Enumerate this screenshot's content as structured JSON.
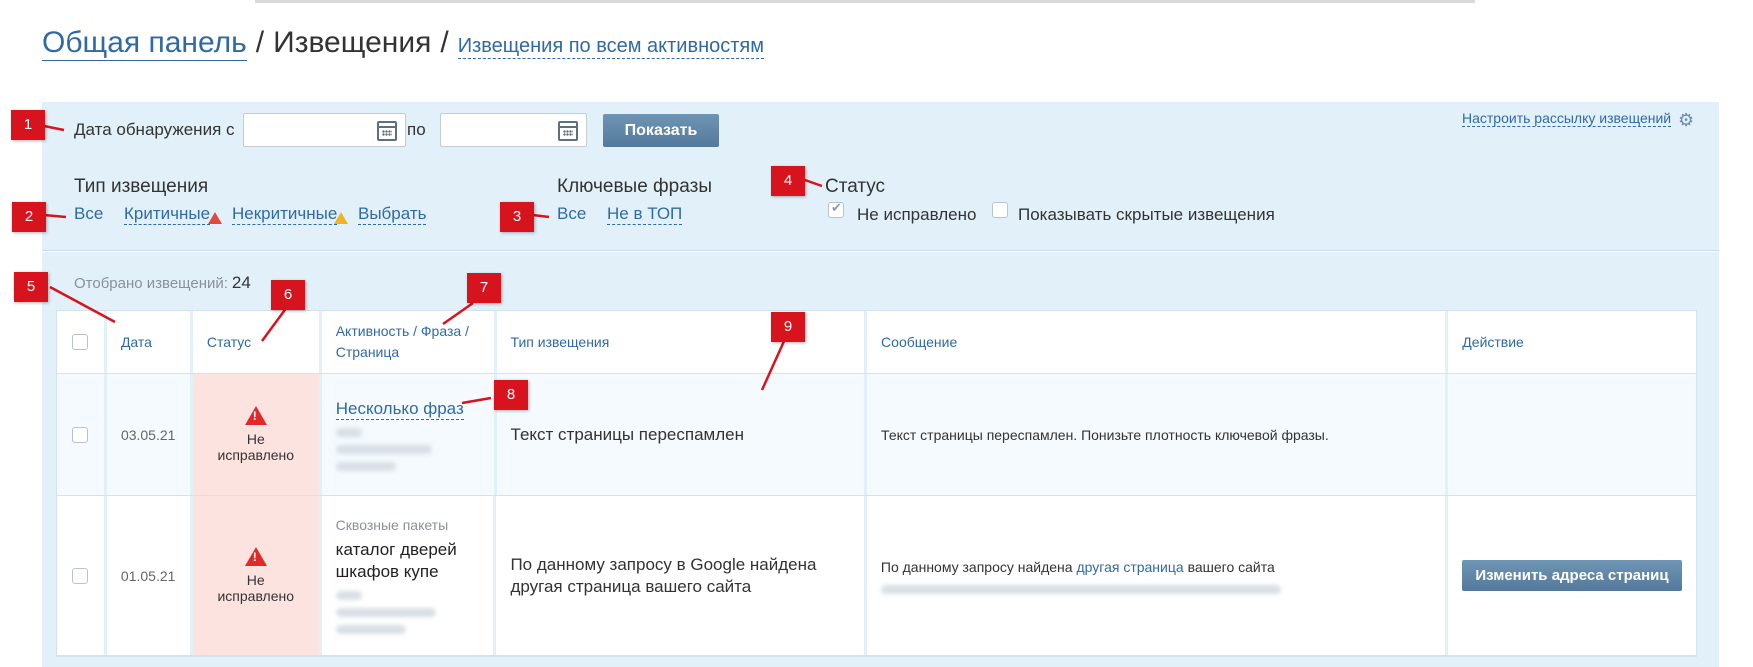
{
  "breadcrumb": {
    "root": "Общая панель",
    "sep1": "/",
    "current": "Извещения",
    "sep2": "/",
    "sub": "Извещения по всем активностям"
  },
  "filter": {
    "date_from_label": "Дата обнаружения с",
    "date_to_label": "по",
    "date_from_value": "",
    "date_to_value": "",
    "show_button": "Показать",
    "settings_link": "Настроить рассылку извещений",
    "notice_type": {
      "title": "Тип извещения",
      "all": "Все",
      "critical": "Критичные",
      "noncritical": "Некритичные",
      "choose": "Выбрать"
    },
    "keyphrases": {
      "title": "Ключевые фразы",
      "all": "Все",
      "not_top": "Не в ТОП"
    },
    "status": {
      "title": "Статус",
      "not_fixed": "Не исправлено",
      "not_fixed_checked": true,
      "show_hidden": "Показывать скрытые извещения",
      "show_hidden_checked": false
    }
  },
  "count": {
    "label": "Отобрано извещений:",
    "value": "24"
  },
  "table": {
    "headers": {
      "date": "Дата",
      "status": "Статус",
      "activity": "Активность / Фраза / Страница",
      "type": "Тип извещения",
      "message": "Сообщение",
      "action": "Действие"
    },
    "rows": [
      {
        "date": "03.05.21",
        "status": "Не исправлено",
        "phrase_link": "Несколько фраз",
        "type": "Текст страницы переспамлен",
        "message": "Текст страницы переспамлен. Понизьте плотность ключевой фразы."
      },
      {
        "date": "01.05.21",
        "status": "Не исправлено",
        "group": "Сквозные пакеты",
        "phrase": "каталог дверей шкафов купе",
        "type": "По данному запросу в Google найдена другая страница вашего сайта",
        "message_pre": "По данному запросу найдена",
        "message_link": "другая страница",
        "message_post": "вашего сайта",
        "action_button": "Изменить адреса страниц"
      }
    ]
  },
  "markers": [
    "1",
    "2",
    "3",
    "4",
    "5",
    "6",
    "7",
    "8",
    "9"
  ],
  "colors": {
    "panel_bg": "#e2f1f9",
    "link": "#2f6aa6",
    "marker": "#d7141e",
    "status_bg": "#fde3df"
  }
}
